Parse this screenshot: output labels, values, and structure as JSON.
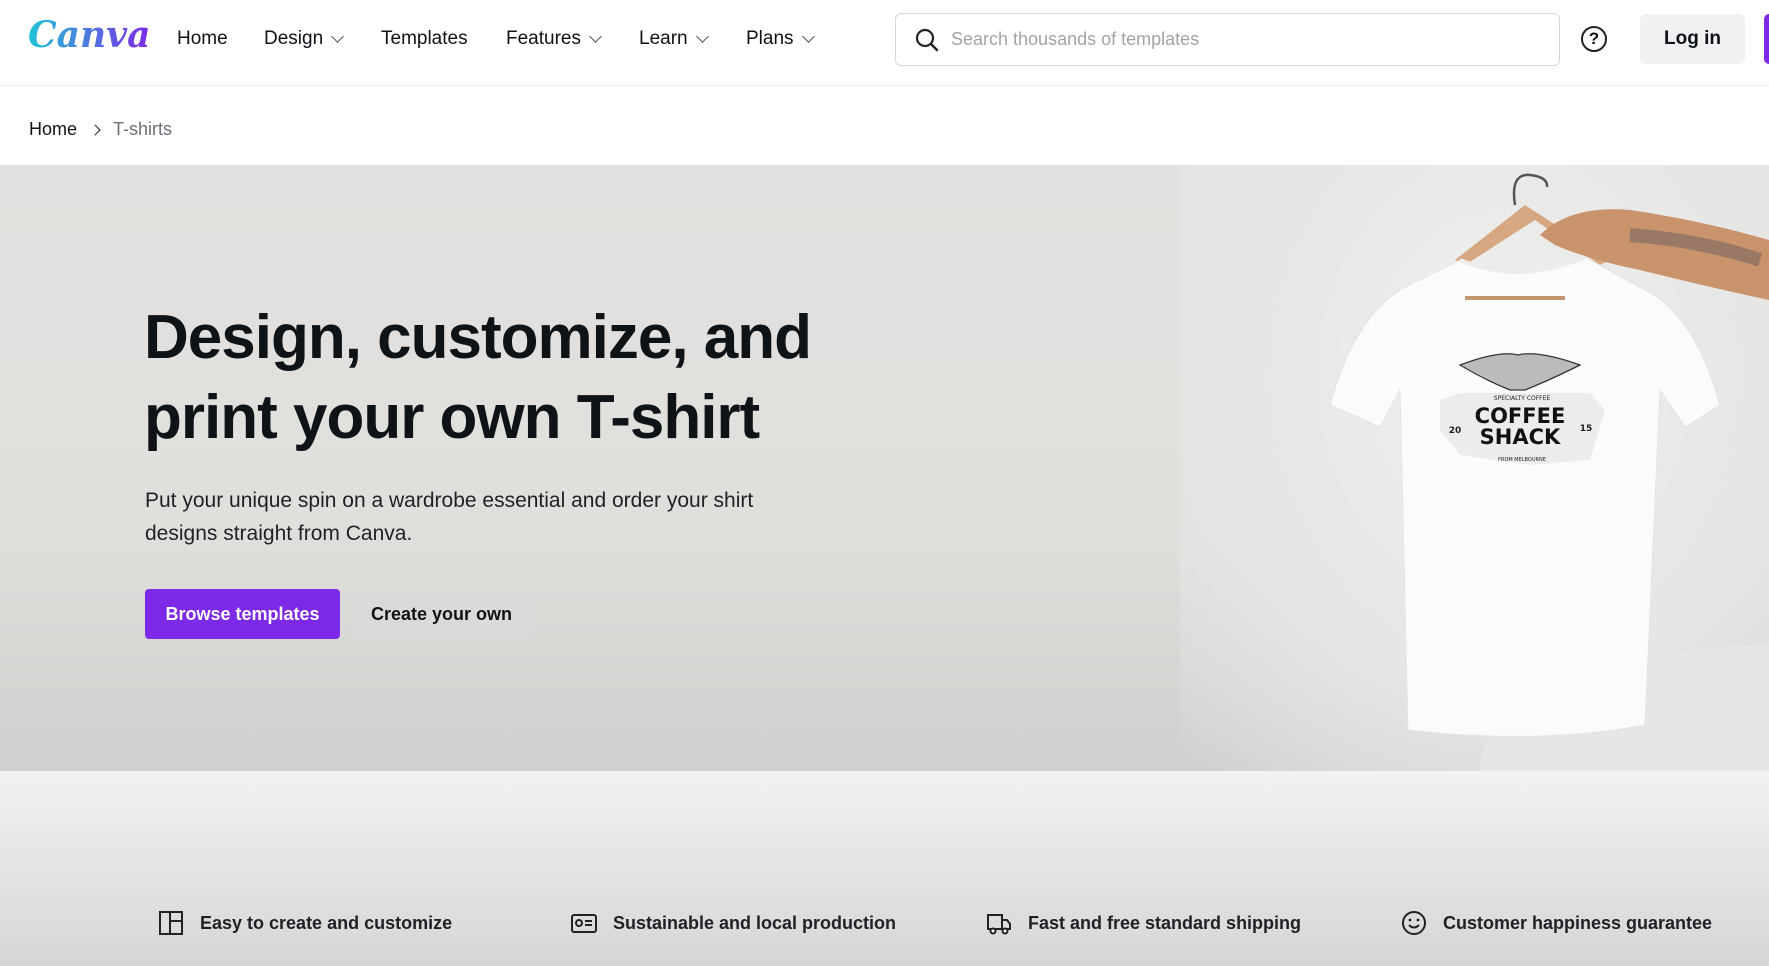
{
  "header": {
    "logo": "Canva",
    "nav": [
      {
        "label": "Home",
        "dropdown": false
      },
      {
        "label": "Design",
        "dropdown": true
      },
      {
        "label": "Templates",
        "dropdown": false
      },
      {
        "label": "Features",
        "dropdown": true
      },
      {
        "label": "Learn",
        "dropdown": true
      },
      {
        "label": "Plans",
        "dropdown": true
      }
    ],
    "search_placeholder": "Search thousands of templates",
    "help": "?",
    "login": "Log in",
    "accent": "#7d2ae8"
  },
  "breadcrumb": [
    "Home",
    "T-shirts"
  ],
  "hero": {
    "title_line1": "Design, customize, and",
    "title_line2": "print your own T-shirt",
    "subtitle": "Put your unique spin on a wardrobe essential and order your shirt designs straight from Canva.",
    "browse": "Browse templates",
    "create": "Create your own",
    "shirt_print": {
      "top": "SPECIALTY COFFEE",
      "line1": "COFFEE",
      "line2": "SHACK",
      "left": "20",
      "right": "15",
      "bottom": "FROM MELBOURNE"
    }
  },
  "features": [
    {
      "icon": "layout-icon",
      "label": "Easy to create and customize"
    },
    {
      "icon": "id-card-icon",
      "label": "Sustainable and local production"
    },
    {
      "icon": "truck-icon",
      "label": "Fast and free standard shipping"
    },
    {
      "icon": "smile-icon",
      "label": "Customer happiness guarantee"
    }
  ]
}
